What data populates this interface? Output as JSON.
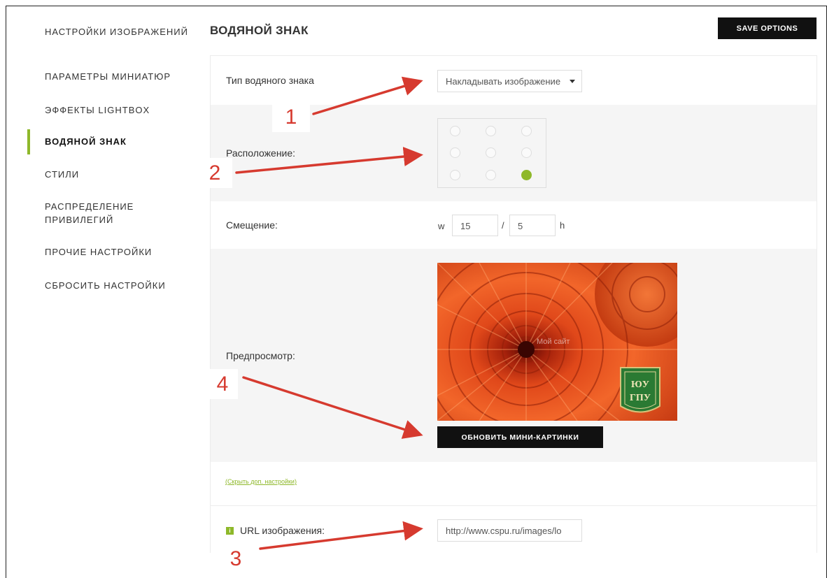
{
  "sidebar": {
    "items": [
      {
        "label": "НАСТРОЙКИ ИЗОБРАЖЕНИЙ",
        "active": false
      },
      {
        "label": "ПАРАМЕТРЫ МИНИАТЮР",
        "active": false
      },
      {
        "label": "ЭФФЕКТЫ LIGHTBOX",
        "active": false
      },
      {
        "label": "ВОДЯНОЙ ЗНАК",
        "active": true
      },
      {
        "label": "СТИЛИ",
        "active": false
      },
      {
        "label": "РАСПРЕДЕЛЕНИЕ ПРИВИЛЕГИЙ",
        "active": false
      },
      {
        "label": "ПРОЧИЕ НАСТРОЙКИ",
        "active": false
      },
      {
        "label": "СБРОСИТЬ НАСТРОЙКИ",
        "active": false
      }
    ]
  },
  "header": {
    "title": "ВОДЯНОЙ ЗНАК",
    "save_label": "SAVE OPTIONS"
  },
  "options": {
    "type_label": "Тип водяного знака",
    "type_value": "Накладывать изображение",
    "position_label": "Расположение:",
    "position_selected": "bottom-right",
    "offset_label": "Смещение:",
    "offset_w_prefix": "w",
    "offset_w_value": "15",
    "offset_separator": "/",
    "offset_h_value": "5",
    "offset_h_suffix": "h",
    "preview_label": "Предпросмотр:",
    "preview_text_watermark": "Мой сайт",
    "update_label": "ОБНОВИТЬ МИНИ-КАРТИНКИ",
    "toggle_link": "(Скрыть доп. настройки)",
    "url_label": "URL изображения:",
    "url_value": "http://www.cspu.ru/images/lo",
    "info_icon_glyph": "i"
  },
  "annotations": {
    "numbers": [
      "1",
      "2",
      "3",
      "4"
    ],
    "color": "#d63a2f"
  },
  "colors": {
    "accent": "#8eb82a",
    "button": "#111111",
    "panel_gray": "#f5f5f5"
  }
}
